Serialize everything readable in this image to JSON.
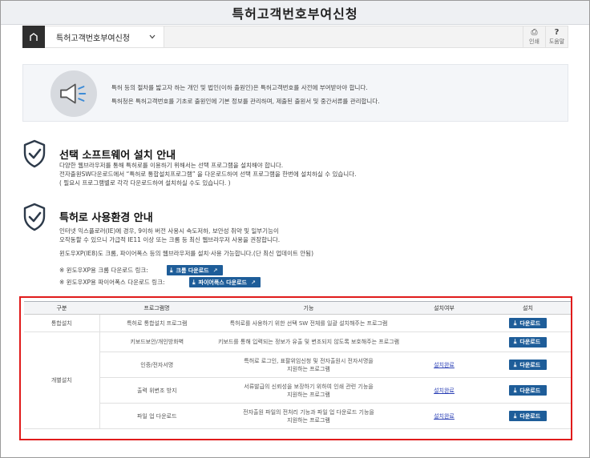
{
  "window": {
    "title": "특허고객번호부여신청"
  },
  "nav": {
    "current_menu": "특허고객번호부여신청",
    "print_label": "인쇄",
    "help_label": "도움말"
  },
  "banner": {
    "line1": "특허 등의 절차를 밟고자 하는 개인 및 법인(이하 출원인)은 특허고객번호를 사전에 부여받아야 합니다.",
    "line2": "특허청은 특허고객번호를 기초로 출원인에 기본 정보를 관리하며, 제출된 출원서 및 중간서류를 관리합니다."
  },
  "section1": {
    "title": "선택 소프트웨어 설치 안내",
    "lines": [
      "다양한 웹브라우저를 통해 특허로를 이용하기 위해서는 선택 프로그램을 설치해야 합니다.",
      "전자출원SW다운로드에서 “특허로 통합설치프로그램” 을 다운로드하여 선택 프로그램을 한번에 설치하실 수 있습니다.",
      "( 필요시 프로그램별로 각각 다운로드하여 설치하실 수도 있습니다. )"
    ]
  },
  "section2": {
    "title": "특허로 사용환경 안내",
    "lines": [
      "인터넷 익스플로러(IE)에 경우, 9이하 버전 사용시 속도저하, 보안성 취약 및 일부기능이",
      "오작동할 수 있으니 가급적 IE11 이상 또는 크롬 등 최신 웹브라우저 사용을 권장합니다.",
      "윈도우XP(IE8)도 크롬, 파이어폭스 등의 웹브라우저를 설치·사용 가능합니다.(단 최신 업데이트 안됨)"
    ],
    "chrome_link_label": "※ 윈도우XP용 크롬 다운로드 링크:",
    "chrome_button": "크롬 다운로드",
    "firefox_link_label": "※ 윈도우XP용 파이어폭스 다운로드 링크:",
    "firefox_button": "파이어폭스 다운로드"
  },
  "table": {
    "headers": [
      "구분",
      "프로그램명",
      "기능",
      "설치여부",
      "설치"
    ],
    "group1": "통합설치",
    "group2": "개별설치",
    "download_label": "다운로드",
    "rows": [
      {
        "name": "특허로 통합설치 프로그램",
        "func1": "특허로를 사용하기 위한 선택 SW 전체를 일괄 설치해주는 프로그램",
        "func2": "",
        "status": ""
      },
      {
        "name": "키보드보안/개인방화벽",
        "func1": "키보드를 통해 입력되는 정보가 유출 및 변조되지 않도록 보호해주는 프로그램",
        "func2": "",
        "status": ""
      },
      {
        "name": "인증/전자서명",
        "func1": "특허로 로그인, 표팔위임신청 및 전자출원시 전자서명을",
        "func2": "지원하는 프로그램",
        "status": "설치완료"
      },
      {
        "name": "출력 위변조 방지",
        "func1": "서류발급의 신뢰성을 보장하기 위하여 인쇄 관련 기능을",
        "func2": "지원하는 프로그램",
        "status": "설치완료"
      },
      {
        "name": "파일 업 다운로드",
        "func1": "전자출원 파일의 전처리 기능과 파일 업 다운로드 기능을",
        "func2": "지원하는 프로그램",
        "status": "설치완료"
      }
    ]
  },
  "colors": {
    "accent": "#1e5d99",
    "highlight_border": "#e01b1b",
    "installed_link": "#2a3fb5"
  }
}
